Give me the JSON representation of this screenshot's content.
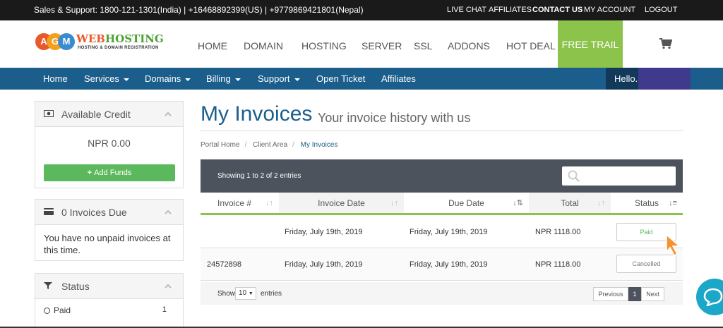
{
  "topbar": {
    "support": "Sales & Support: 1800-121-1301(India) | +16468892399(US) | +9779869421801(Nepal)",
    "links": [
      "LIVE CHAT",
      "AFFILIATES",
      "CONTACT US",
      "MY ACCOUNT",
      "LOGOUT"
    ]
  },
  "logo": {
    "letters": [
      "A",
      "G",
      "M"
    ],
    "web": "WEB",
    "hosting": "HOSTING",
    "tagline": "HOSTING & DOMAIN REGISTRATION"
  },
  "mainnav": [
    "HOME",
    "DOMAIN",
    "HOSTING",
    "SERVER",
    "SSL",
    "ADDONS",
    "HOT DEAL"
  ],
  "free_trail": "FREE TRAIL",
  "bluenav": {
    "items": [
      "Home",
      "Services",
      "Domains",
      "Billing",
      "Support",
      "Open Ticket",
      "Affiliates"
    ],
    "hello": "Hello."
  },
  "sidebar": {
    "credit": {
      "title": "Available Credit",
      "amount": "NPR 0.00",
      "button": "Add Funds"
    },
    "due": {
      "title": "0 Invoices Due",
      "text": "You have no unpaid invoices at this time."
    },
    "status": {
      "title": "Status",
      "items": [
        {
          "label": "Paid",
          "count": "1"
        }
      ]
    }
  },
  "page": {
    "title": "My Invoices",
    "subtitle": "Your invoice history with us",
    "breadcrumb": [
      "Portal Home",
      "Client Area",
      "My Invoices"
    ]
  },
  "table": {
    "info": "Showing 1 to 2 of 2 entries",
    "columns": [
      "Invoice #",
      "Invoice Date",
      "Due Date",
      "Total",
      "Status"
    ],
    "rows": [
      {
        "invoice": "",
        "invoice_date": "Friday, July 19th, 2019",
        "due_date": "Friday, July 19th, 2019",
        "total": "NPR 1118.00",
        "status": "Paid"
      },
      {
        "invoice": "24572898",
        "invoice_date": "Friday, July 19th, 2019",
        "due_date": "Friday, July 19th, 2019",
        "total": "NPR 1118.00",
        "status": "Cancelled"
      }
    ],
    "footer": {
      "show": "Show",
      "length": "10",
      "entries": "entries",
      "prev": "Previous",
      "page": "1",
      "next": "Next"
    }
  },
  "colors": {
    "brand_blue": "#1b5e8c",
    "accent_green": "#8cc34b",
    "status_paid": "#5cb85c",
    "chat": "#1aa7c8"
  }
}
